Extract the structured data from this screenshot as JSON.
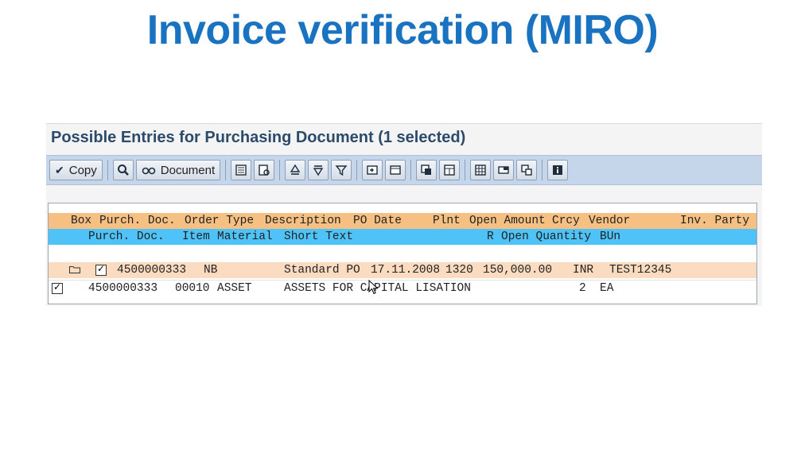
{
  "slide": {
    "title": "Invoice verification (MIRO)"
  },
  "dialog": {
    "title": "Possible Entries for Purchasing Document (1 selected)",
    "toolbar": {
      "copy_label": "Copy",
      "document_label": "Document"
    },
    "table": {
      "header1": [
        "Box",
        "Purch. Doc.",
        "Order Type",
        "Description",
        "PO Date",
        "Plnt",
        "Open Amount",
        "Crcy",
        "Vendor",
        "Inv. Party"
      ],
      "header2": [
        "Purch. Doc.",
        "Item",
        "Material",
        "Short Text",
        "R",
        "Open Quantity",
        "BUn"
      ],
      "row1": {
        "purch_doc": "4500000333",
        "order_type": "NB",
        "description": "Standard PO",
        "po_date": "17.11.2008",
        "plant": "1320",
        "open_amount": "150,000.00",
        "currency": "INR",
        "vendor": "TEST12345",
        "selected": true
      },
      "row2": {
        "purch_doc": "4500000333",
        "item": "00010",
        "material": "ASSET",
        "short_text": "ASSETS FOR CAPITAL LISATION",
        "open_quantity": "2",
        "unit": "EA",
        "selected": true
      }
    }
  },
  "icons": {
    "copy": "check-icon",
    "find": "find-icon",
    "document": "glasses-icon"
  }
}
